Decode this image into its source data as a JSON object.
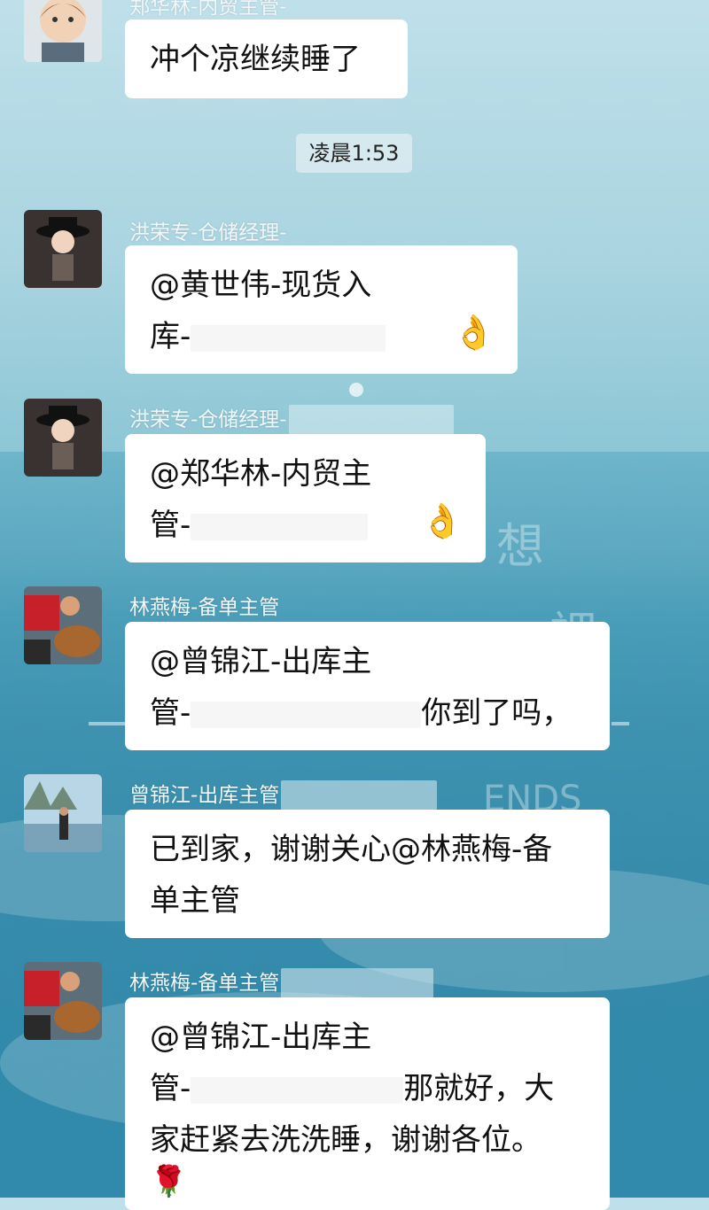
{
  "messages": [
    {
      "sender": "郑华林-内贸主管-",
      "lines": [
        "冲个凉继续睡了"
      ]
    },
    {
      "sender": "洪荣专-仓储经理-",
      "lines": [
        "@黄世伟-现货入",
        "库-"
      ],
      "emoji": "ok-hand-icon"
    },
    {
      "sender": "洪荣专-仓储经理-",
      "lines": [
        "@郑华林-内贸主",
        "管-"
      ],
      "emoji": "ok-hand-icon"
    },
    {
      "sender": "林燕梅-备单主管",
      "lines": [
        "@曾锦江-出库主",
        "管-"
      ],
      "tail": "你到了吗，"
    },
    {
      "sender": "曾锦江-出库主管",
      "lines": [
        "已到家，谢谢关心@林燕梅-备",
        "单主管"
      ]
    },
    {
      "sender": "林燕梅-备单主管",
      "lines": [
        "@曾锦江-出库主",
        "管-",
        "家赶紧去洗洗睡，谢谢各位。"
      ],
      "tail": "那就好，大",
      "emoji": "rose-icon"
    }
  ],
  "timestamp": "凌晨1:53",
  "colors": {
    "bubble": "#ffffff",
    "sender_name": "#f2f7f9",
    "time_pill": "#dfecef"
  }
}
